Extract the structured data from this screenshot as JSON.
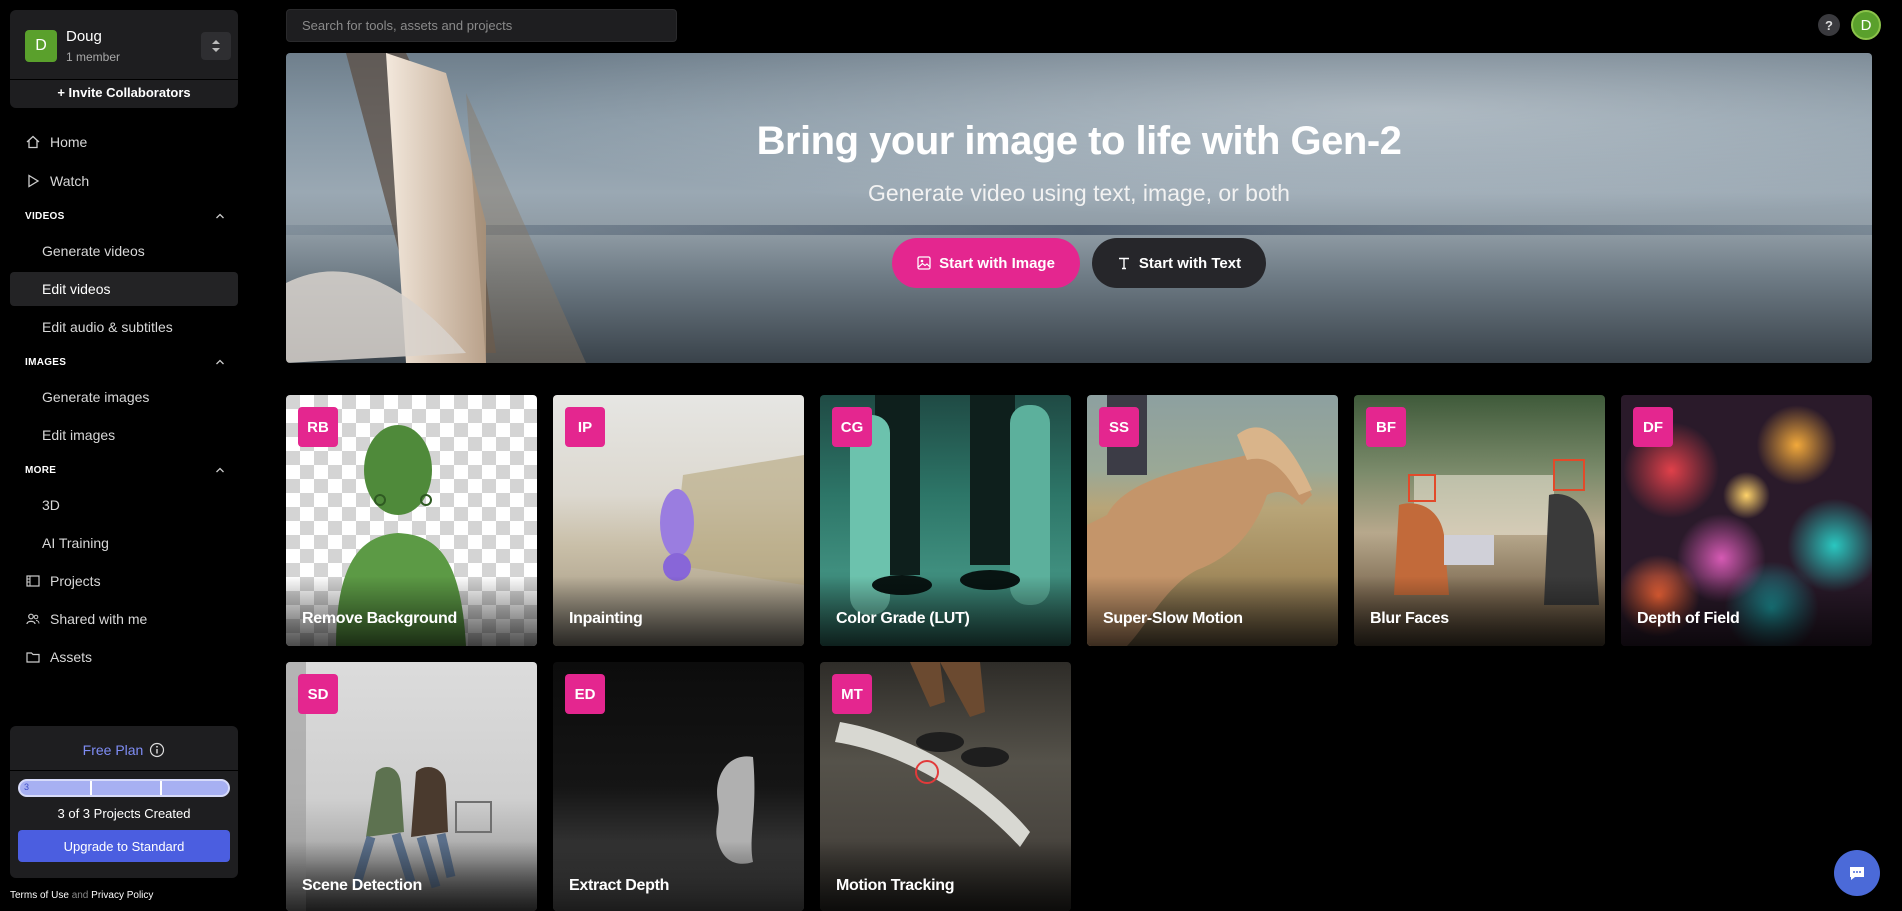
{
  "workspace": {
    "avatar_letter": "D",
    "name": "Doug",
    "members": "1 member",
    "invite_label": "+ Invite Collaborators"
  },
  "nav": {
    "home": "Home",
    "watch": "Watch",
    "videos_section": "VIDEOS",
    "generate_videos": "Generate videos",
    "edit_videos": "Edit videos",
    "edit_audio": "Edit audio & subtitles",
    "images_section": "IMAGES",
    "generate_images": "Generate images",
    "edit_images": "Edit images",
    "more_section": "MORE",
    "three_d": "3D",
    "ai_training": "AI Training",
    "projects": "Projects",
    "shared": "Shared with me",
    "assets": "Assets"
  },
  "plan": {
    "title": "Free Plan",
    "progress_used": 3,
    "progress_total": 3,
    "progress_marker": "3",
    "count_text": "3 of 3 Projects Created",
    "upgrade_label": "Upgrade to Standard"
  },
  "footer": {
    "terms": "Terms of Use",
    "and": "and",
    "privacy": "Privacy Policy"
  },
  "topbar": {
    "search_placeholder": "Search for tools, assets and projects",
    "help": "?",
    "user_avatar_letter": "D"
  },
  "hero": {
    "title": "Bring your image to life with Gen-2",
    "subtitle": "Generate video using text, image, or both",
    "btn_image": "Start with Image",
    "btn_text": "Start with Text"
  },
  "tools": [
    {
      "badge": "RB",
      "label": "Remove Background"
    },
    {
      "badge": "IP",
      "label": "Inpainting"
    },
    {
      "badge": "CG",
      "label": "Color Grade (LUT)"
    },
    {
      "badge": "SS",
      "label": "Super-Slow Motion"
    },
    {
      "badge": "BF",
      "label": "Blur Faces"
    },
    {
      "badge": "DF",
      "label": "Depth of Field"
    },
    {
      "badge": "SD",
      "label": "Scene Detection"
    },
    {
      "badge": "ED",
      "label": "Extract Depth"
    },
    {
      "badge": "MT",
      "label": "Motion Tracking"
    }
  ],
  "colors": {
    "accent_pink": "#e4268f",
    "upgrade_blue": "#4b5ee0",
    "avatar_green": "#5aa02c"
  }
}
